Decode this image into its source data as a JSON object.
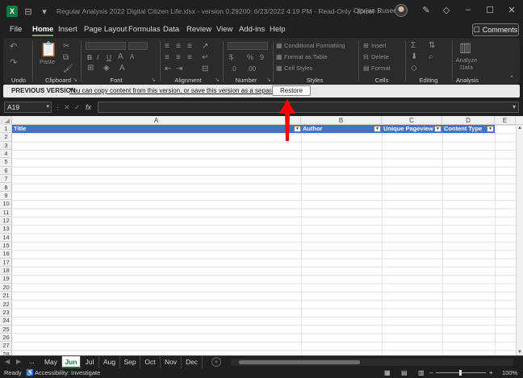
{
  "titlebar": {
    "filename": "Regular Analysis 2022 Digital Citizen Life.xlsx",
    "version_info": "version 0.29200: 6/23/2022 4:19 PM",
    "mode": "Read-Only",
    "app": "Excel",
    "separator": "-",
    "user": "Ciprian Rusen"
  },
  "menu": {
    "tabs": [
      "File",
      "Home",
      "Insert",
      "Page Layout",
      "Formulas",
      "Data",
      "Review",
      "View",
      "Add-ins",
      "Help"
    ],
    "active": "Home",
    "comments_label": "Comments"
  },
  "ribbon": {
    "groups": {
      "undo": "Undo",
      "clipboard": "Clipboard",
      "font": "Font",
      "alignment": "Alignment",
      "number": "Number",
      "styles": "Styles",
      "cells": "Cells",
      "editing": "Editing",
      "analysis": "Analysis"
    },
    "paste_label": "Paste",
    "conditional_formatting": "Conditional Formatting",
    "format_as_table": "Format as Table",
    "cell_styles": "Cell Styles",
    "insert": "Insert",
    "delete": "Delete",
    "format": "Format",
    "analyze_data_line1": "Analyze",
    "analyze_data_line2": "Data",
    "bold": "B",
    "italic": "I",
    "underline": "U",
    "currency": "$",
    "percent": "%",
    "comma": "9"
  },
  "infobar": {
    "label": "PREVIOUS VERSION",
    "message": "You can copy content from this version, or save this version as a separate file.",
    "restore_label": "Restore"
  },
  "formulabar": {
    "cell_ref": "A19",
    "fx": "fx",
    "value": ""
  },
  "grid": {
    "columns": [
      "A",
      "B",
      "C",
      "D",
      "E"
    ],
    "rows": [
      "1",
      "2",
      "3",
      "4",
      "5",
      "6",
      "7",
      "8",
      "9",
      "10",
      "11",
      "12",
      "13",
      "14",
      "15",
      "16",
      "17",
      "18",
      "19",
      "20",
      "21",
      "22",
      "23",
      "24",
      "25",
      "26",
      "27",
      "28"
    ],
    "headers": [
      "Title",
      "Author",
      "Unique Pageviews",
      "Content Type"
    ]
  },
  "sheets": {
    "tabs": [
      "May",
      "Jun",
      "Jul",
      "Aug",
      "Sep",
      "Oct",
      "Nov",
      "Dec"
    ],
    "active": "Jun",
    "ellipsis": "..."
  },
  "status": {
    "ready": "Ready",
    "accessibility": "Accessibility: Investigate",
    "zoom": "100%"
  },
  "colors": {
    "accent": "#58b27c",
    "table_header": "#4472c4",
    "annotation_arrow": "#ff0000",
    "excel_green": "#107c41"
  }
}
